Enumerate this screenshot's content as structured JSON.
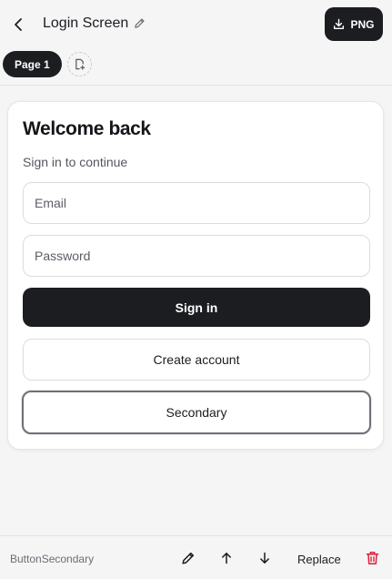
{
  "header": {
    "title": "Login Screen",
    "export_label": "PNG",
    "page_tab": "Page 1"
  },
  "card": {
    "heading": "Welcome back",
    "subtitle": "Sign in to continue",
    "email_placeholder": "Email",
    "password_placeholder": "Password",
    "primary_button": "Sign in",
    "outline_button": "Create account",
    "secondary_button": "Secondary"
  },
  "footer": {
    "selected_component": "ButtonSecondary",
    "replace_label": "Replace"
  },
  "colors": {
    "dark": "#1c1d21",
    "danger": "#d9213a",
    "background": "#f5f5f6"
  },
  "icons": [
    "back-arrow-icon",
    "pencil-icon",
    "download-icon",
    "add-page-icon",
    "arrow-up-icon",
    "arrow-down-icon",
    "trash-icon"
  ]
}
